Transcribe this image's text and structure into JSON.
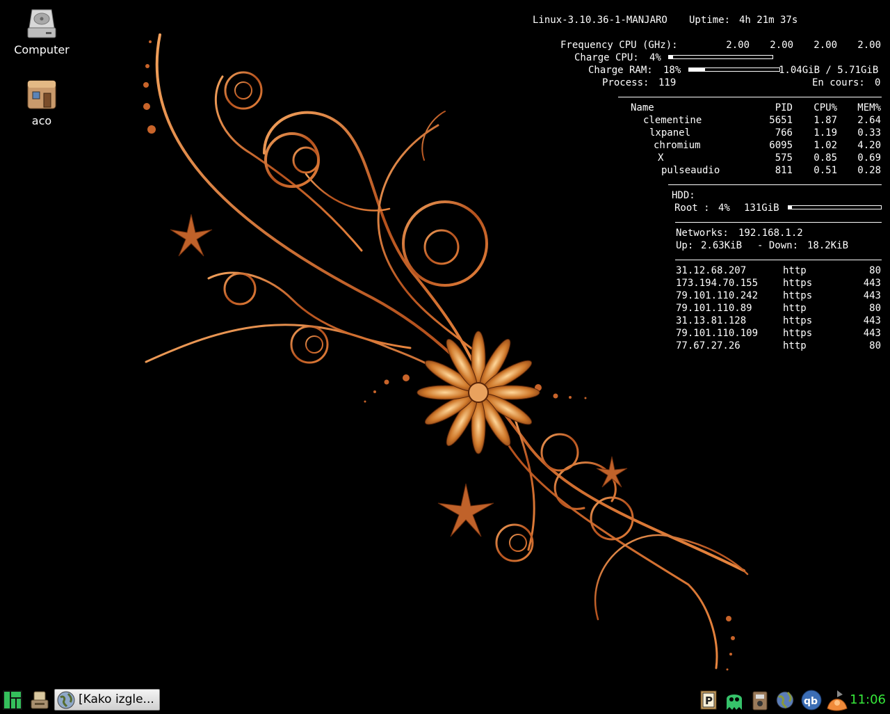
{
  "desktop": {
    "icons": [
      {
        "label": "Computer",
        "icon": "hard-drive-icon"
      },
      {
        "label": "aco",
        "icon": "home-folder-icon"
      }
    ]
  },
  "conky": {
    "kernel": "Linux-3.10.36-1-MANJARO",
    "uptime_label": "Uptime:",
    "uptime_value": "4h 21m 37s",
    "freq_label": "Frequency CPU (GHz):",
    "freq_values": [
      "2.00",
      "2.00",
      "2.00",
      "2.00"
    ],
    "cpu_label": "Charge CPU:",
    "cpu_value": "4%",
    "cpu_fraction": 0.04,
    "ram_label": "Charge RAM:",
    "ram_value": "18%",
    "ram_fraction": 0.18,
    "ram_usage": "1.04GiB / 5.71GiB",
    "process_label": "Process:",
    "process_value": "119",
    "running_label": "En cours:",
    "running_value": "0",
    "proc_headers": [
      "Name",
      "PID",
      "CPU%",
      "MEM%"
    ],
    "procs": [
      {
        "name": "clementine",
        "pid": "5651",
        "cpu": "1.87",
        "mem": "2.64"
      },
      {
        "name": "lxpanel",
        "pid": "766",
        "cpu": "1.19",
        "mem": "0.33"
      },
      {
        "name": "chromium",
        "pid": "6095",
        "cpu": "1.02",
        "mem": "4.20"
      },
      {
        "name": "X",
        "pid": "575",
        "cpu": "0.85",
        "mem": "0.69"
      },
      {
        "name": "pulseaudio",
        "pid": "811",
        "cpu": "0.51",
        "mem": "0.28"
      }
    ],
    "hdd_label": "HDD:",
    "root_label": "Root :",
    "root_value": "4%",
    "root_size": "131GiB",
    "root_fraction": 0.04,
    "net_label": "Networks:",
    "net_ip": "192.168.1.2",
    "up_label": "Up:",
    "up_value": "2.63KiB",
    "down_label": "- Down:",
    "down_value": "18.2KiB",
    "connections": [
      {
        "ip": "31.12.68.207",
        "proto": "http",
        "port": "80"
      },
      {
        "ip": "173.194.70.155",
        "proto": "https",
        "port": "443"
      },
      {
        "ip": "79.101.110.242",
        "proto": "https",
        "port": "443"
      },
      {
        "ip": "79.101.110.89",
        "proto": "http",
        "port": "80"
      },
      {
        "ip": "31.13.81.128",
        "proto": "https",
        "port": "443"
      },
      {
        "ip": "79.101.110.109",
        "proto": "https",
        "port": "443"
      },
      {
        "ip": "77.67.27.26",
        "proto": "http",
        "port": "80"
      }
    ]
  },
  "panel": {
    "menu_icon": "manjaro-menu-icon",
    "show_desktop_icon": "show-desktop-icon",
    "task_title": "[Kako izgle...",
    "task_icon": "browser-globe-icon",
    "tray_icons": [
      "pamac-updater-icon",
      "ghost-icon",
      "package-manager-icon",
      "network-globe-icon",
      "qbittorrent-icon",
      "clementine-icon"
    ],
    "clock": "11:06",
    "clock_color": "#36e83a"
  },
  "colors": {
    "background": "#000000",
    "ornament": "#c8642a"
  }
}
